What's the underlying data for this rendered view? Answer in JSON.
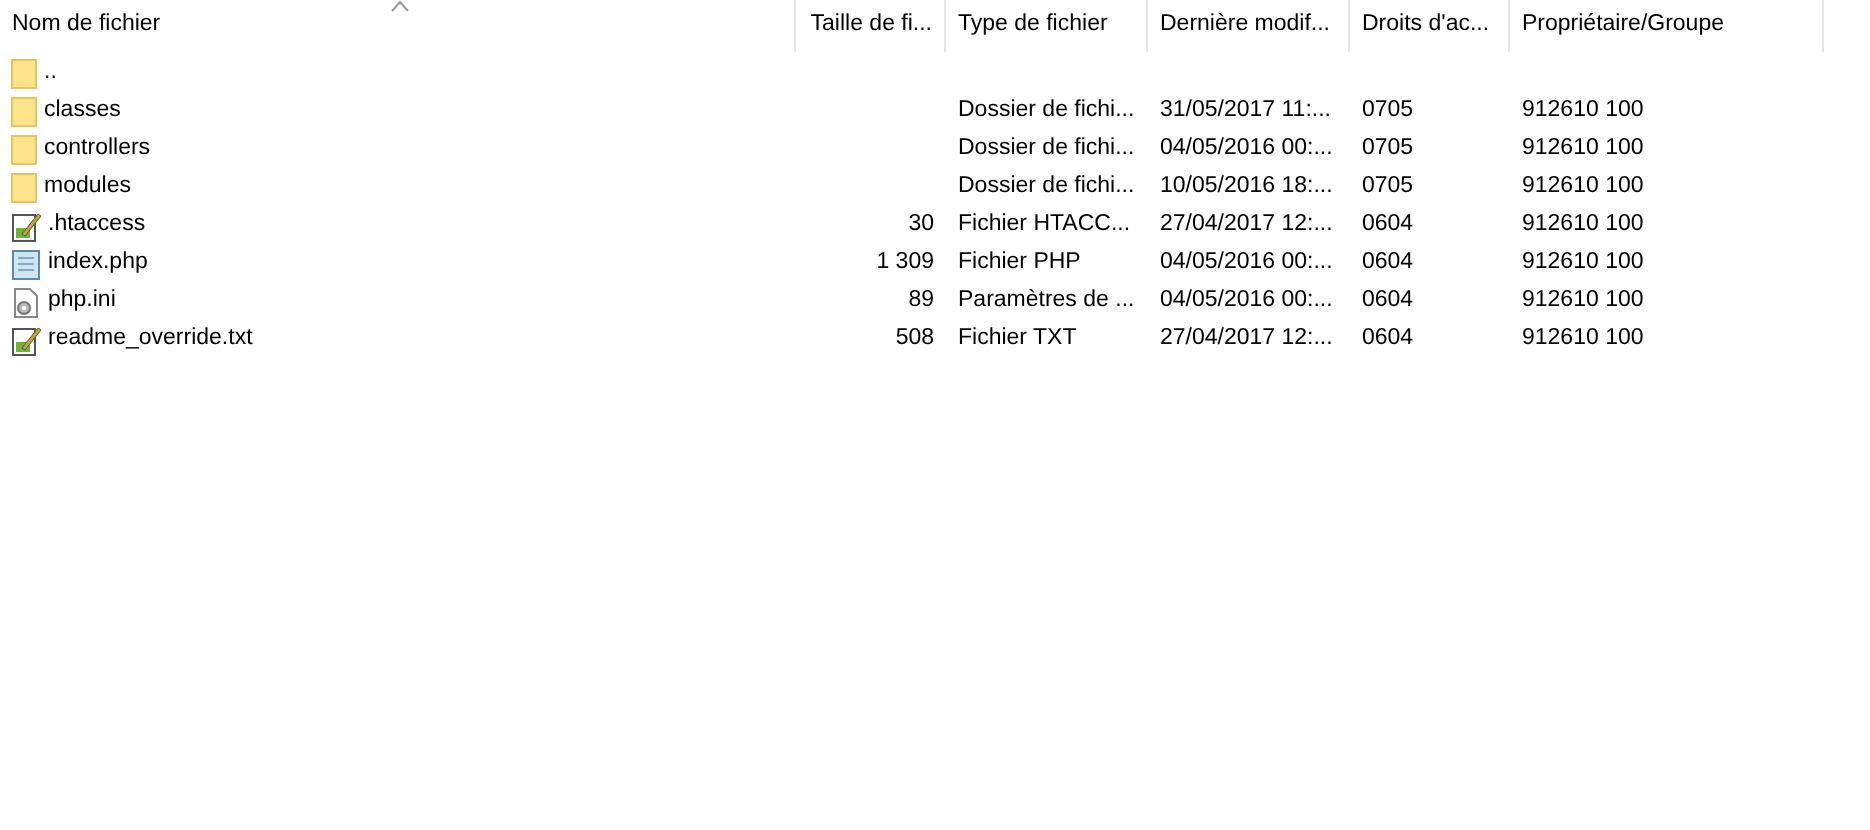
{
  "table": {
    "columns": [
      "Nom de fichier",
      "Taille de fi...",
      "Type de fichier",
      "Dernière modif...",
      "Droits d'ac...",
      "Propriétaire/Groupe"
    ],
    "rows": [
      {
        "kind": "folder",
        "name": "..",
        "size": "",
        "type": "",
        "modified": "",
        "rights": "",
        "owner": ""
      },
      {
        "kind": "folder",
        "name": "classes",
        "size": "",
        "type": "Dossier de fichi...",
        "modified": "31/05/2017 11:...",
        "rights": "0705",
        "owner": "912610 100"
      },
      {
        "kind": "folder",
        "name": "controllers",
        "size": "",
        "type": "Dossier de fichi...",
        "modified": "04/05/2016 00:...",
        "rights": "0705",
        "owner": "912610 100"
      },
      {
        "kind": "folder",
        "name": "modules",
        "size": "",
        "type": "Dossier de fichi...",
        "modified": "10/05/2016 18:...",
        "rights": "0705",
        "owner": "912610 100"
      },
      {
        "kind": "edit",
        "name": ".htaccess",
        "size": "30",
        "type": "Fichier HTACC...",
        "modified": "27/04/2017 12:...",
        "rights": "0604",
        "owner": "912610 100"
      },
      {
        "kind": "text",
        "name": "index.php",
        "size": "1 309",
        "type": "Fichier PHP",
        "modified": "04/05/2016 00:...",
        "rights": "0604",
        "owner": "912610 100"
      },
      {
        "kind": "settings",
        "name": "php.ini",
        "size": "89",
        "type": "Paramètres de ...",
        "modified": "04/05/2016 00:...",
        "rights": "0604",
        "owner": "912610 100"
      },
      {
        "kind": "edit",
        "name": "readme_override.txt",
        "size": "508",
        "type": "Fichier TXT",
        "modified": "27/04/2017 12:...",
        "rights": "0604",
        "owner": "912610 100"
      }
    ]
  }
}
